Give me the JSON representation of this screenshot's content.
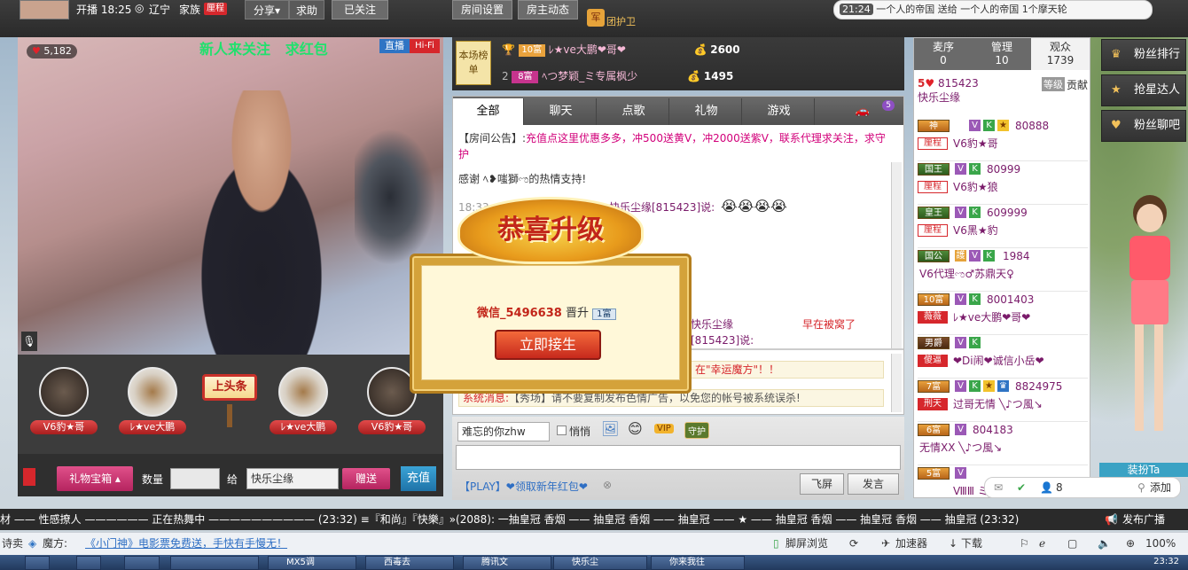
{
  "topbar": {
    "status": "开播 18:25",
    "location": "辽宁",
    "family": "家族",
    "family_badge": "厘程",
    "share": "分享▾",
    "help": "求助",
    "followed": "已关注",
    "room_settings": "房间设置",
    "host_news": "房主动态",
    "guard_icon_text": "军",
    "guard": "团护卫",
    "ticker_time": "21:24",
    "ticker_text": "一个人的帝国 送给 一个人的帝国 1个摩天轮"
  },
  "video": {
    "fans_count": "5,182",
    "banner": "新人来关注   求红包",
    "live": "直播",
    "hifi": "Hi-Fi"
  },
  "gifts": {
    "items": [
      "V6豹★哥",
      "ﾚ★ve大鹏",
      "上头条",
      "ﾚ★ve大鹏",
      "V6豹★哥"
    ]
  },
  "controls": {
    "gift_box": "礼物宝箱 ▴",
    "quantity_label": "数量",
    "to_label": "给",
    "recipient": "快乐尘缘",
    "send": "赠送",
    "recharge": "充值"
  },
  "rank": {
    "label": "本场榜单",
    "rows": [
      {
        "pos": "1",
        "level": "10富",
        "name": "ﾚ★ve大鹏❤哥❤",
        "score": "2600"
      },
      {
        "pos": "2",
        "level": "8富",
        "name": "ﾍつ梦颖_ミ专属枫少",
        "score": "1495"
      }
    ]
  },
  "chat": {
    "tabs": [
      "全部",
      "聊天",
      "点歌",
      "礼物",
      "游戏"
    ],
    "car_count": "5",
    "announce_label": "【房间公告】:",
    "announce_text": "充值点这里优惠多多，冲500送黄V，冲2000送紫V，联系代理求关注，求守护",
    "msg_thanks": "感谢 ﾍ❥嗤獅ಌ的热情支持!",
    "msg_time": "18:33",
    "msg_user": "快乐尘缘[815423]说:",
    "msg2_user": "快乐尘缘[815423]说:",
    "msg2_text": "早在被窝了",
    "sys1_text": "在\"幸运魔方\"！！",
    "sys2_label": "系统消息:",
    "sys2_text": "【秀场】请不要复制发布色情广告，以免您的帐号被系统误杀!"
  },
  "input": {
    "target": "难忘的你zhw",
    "whisper": "悄悄",
    "vip": "VIP",
    "guard": "守护",
    "play_link": "【PLAY】❤领取新年红包❤",
    "fly_screen": "飞屏",
    "send": "发言"
  },
  "right": {
    "tabs": [
      {
        "label": "麦序",
        "count": "0"
      },
      {
        "label": "管理",
        "count": "10"
      },
      {
        "label": "观众",
        "count": "1739"
      }
    ],
    "top_rank": "5",
    "top_id": "815423",
    "top_name": "快乐尘缘",
    "level_label": "等级",
    "contrib_label": "贡献",
    "users": [
      {
        "level": "神",
        "id": "80888",
        "tag": "厘程",
        "name": "V6豹★哥"
      },
      {
        "level": "国王",
        "id": "80999",
        "tag": "厘程",
        "name": "V6豹★狼"
      },
      {
        "level": "皇王",
        "id": "609999",
        "tag": "厘程",
        "name": "V6黑★豹"
      },
      {
        "level": "国公",
        "id": "1984",
        "tag": "",
        "name": "V6代理ಌ♂苏鼎天♀"
      },
      {
        "level": "10富",
        "id": "8001403",
        "tag": "薇薇",
        "name": "ﾚ★ve大鹏❤哥❤"
      },
      {
        "level": "男爵",
        "id": "",
        "tag": "傻逼",
        "name": "❤Di闹❤诚信小岳❤"
      },
      {
        "level": "7富",
        "id": "8824975",
        "tag": "刑天",
        "name": "过哥无情 ╲♪つ風↘"
      },
      {
        "level": "6富",
        "id": "804183",
        "tag": "",
        "name": "无情XX ╲♪つ風↘"
      },
      {
        "level": "5富",
        "id": "",
        "tag": "",
        "name": "ⅧⅢ ミ★"
      }
    ],
    "notif_count": "8",
    "add_label": "添加"
  },
  "side": {
    "fans_rank": "粉丝排行",
    "star_grab": "抢星达人",
    "fans_chat": "粉丝聊吧",
    "costume": "装扮Ta"
  },
  "marquee": {
    "text": "材 —— 性感撩人 —————— 正在热舞中 —————————— (23:32)   ≡『和尚』『快樂』»(2088): 一抽皇冠  香烟 —— 抽皇冠  香烟 —— 抽皇冠 —— ★ —— 抽皇冠  香烟 —— 抽皇冠  香烟 —— 抽皇冠 (23:32)",
    "broadcast": "发布广播"
  },
  "statusbar": {
    "left": "诗卖",
    "magic_label": "魔方:",
    "magic_link": "《小门神》电影票免费送，手快有手慢无！",
    "view": "脚屏浏览",
    "accelerator": "加速器",
    "download": "下载",
    "zoom": "100%"
  },
  "taskbar": {
    "clock": "23:32",
    "items": [
      "",
      "",
      "",
      "",
      "MX5调",
      "西毒去",
      "腾讯文",
      "快乐尘",
      "你来我往"
    ]
  },
  "popup": {
    "title": "恭喜升级",
    "user": "微信_5496638",
    "promoted": "晋升",
    "new_level": "1富",
    "button": "立即接生"
  },
  "colors": {
    "accent_red": "#d6272c",
    "chat_pink": "#d2007a",
    "gold": "#d4a23a"
  }
}
